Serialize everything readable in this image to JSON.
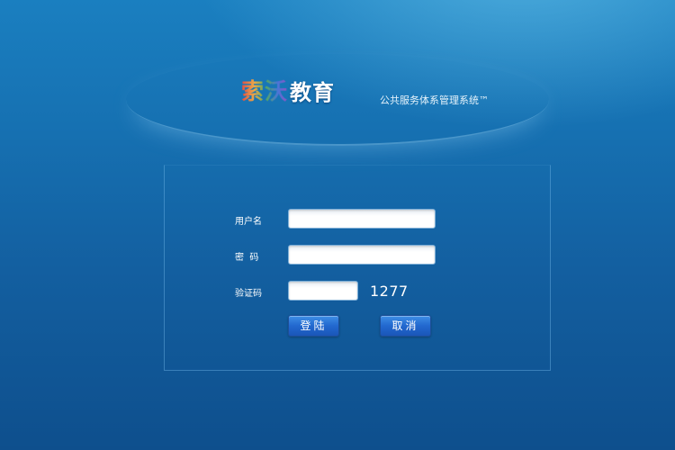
{
  "brand": {
    "logo_mark": "索沃",
    "logo_word": "教育",
    "subtitle": "公共服务体系管理系统™"
  },
  "login_form": {
    "username_label": "用户名",
    "username_value": "",
    "password_label": "密  码",
    "password_value": "",
    "captcha_label": "验证码",
    "captcha_value": "",
    "captcha_code": "1277",
    "login_button": "登陆",
    "cancel_button": "取消"
  },
  "colors": {
    "background_top": "#1a7fc0",
    "background_bottom": "#0e4f8d",
    "button": "#2268cf"
  }
}
